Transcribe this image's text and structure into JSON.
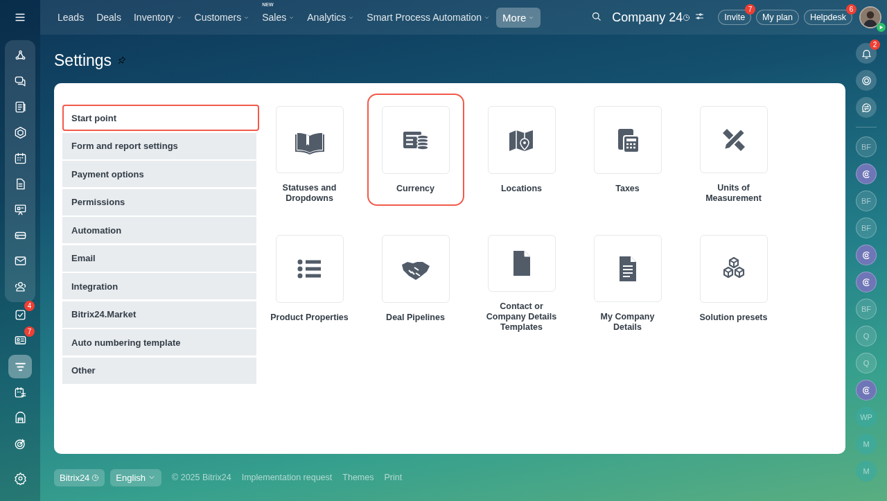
{
  "top_nav": {
    "items": [
      {
        "label": "Leads"
      },
      {
        "label": "Deals"
      },
      {
        "label": "Inventory",
        "dropdown": true
      },
      {
        "label": "Customers",
        "dropdown": true
      },
      {
        "label": "Sales",
        "dropdown": true,
        "tag": "NEW"
      },
      {
        "label": "Analytics",
        "dropdown": true
      },
      {
        "label": "Smart Process Automation",
        "dropdown": true
      },
      {
        "label": "More",
        "dropdown": true,
        "selected": true
      }
    ],
    "company": "Company 24",
    "buttons": [
      {
        "label": "Invite",
        "badge": "7"
      },
      {
        "label": "My plan"
      },
      {
        "label": "Helpdesk",
        "badge": "6"
      }
    ]
  },
  "left_rail": {
    "items": [
      {
        "badge": "4",
        "selected": false
      },
      {
        "badge": "7",
        "selected": false
      },
      {
        "selected": true
      },
      {
        "selected": false
      },
      {
        "selected": false
      },
      {
        "selected": false
      }
    ]
  },
  "page_title": "Settings",
  "settings_menu": [
    {
      "label": "Start point",
      "selected": true,
      "highlighted": true
    },
    {
      "label": "Form and report settings",
      "selected": false,
      "highlighted": false
    },
    {
      "label": "Payment options",
      "selected": false,
      "highlighted": false
    },
    {
      "label": "Permissions",
      "selected": false,
      "highlighted": false
    },
    {
      "label": "Automation",
      "selected": false,
      "highlighted": false
    },
    {
      "label": "Email",
      "selected": false,
      "highlighted": false
    },
    {
      "label": "Integration",
      "selected": false,
      "highlighted": false
    },
    {
      "label": "Bitrix24.Market",
      "selected": false,
      "highlighted": false
    },
    {
      "label": "Auto numbering template",
      "selected": false,
      "highlighted": false
    },
    {
      "label": "Other",
      "selected": false,
      "highlighted": false
    }
  ],
  "tiles": [
    {
      "label": "Statuses and Dropdowns",
      "highlighted": false
    },
    {
      "label": "Currency",
      "highlighted": true
    },
    {
      "label": "Locations",
      "highlighted": false
    },
    {
      "label": "Taxes",
      "highlighted": false
    },
    {
      "label": "Units of Measurement",
      "highlighted": false
    },
    {
      "label": "Product Properties",
      "highlighted": false
    },
    {
      "label": "Deal Pipelines",
      "highlighted": false
    },
    {
      "label": "Contact or Company Details Templates",
      "highlighted": false
    },
    {
      "label": "My Company Details",
      "highlighted": false
    },
    {
      "label": "Solution presets",
      "highlighted": false
    }
  ],
  "right_rail": {
    "notifications_badge": "2",
    "contacts": [
      {
        "kind": "initials",
        "text": "BF"
      },
      {
        "kind": "bot"
      },
      {
        "kind": "initials",
        "text": "BF"
      },
      {
        "kind": "initials",
        "text": "BF"
      },
      {
        "kind": "bot"
      },
      {
        "kind": "bot"
      },
      {
        "kind": "initials",
        "text": "BF"
      },
      {
        "kind": "initials",
        "text": "Q"
      },
      {
        "kind": "initials",
        "text": "Q"
      },
      {
        "kind": "bot"
      },
      {
        "kind": "initials",
        "text": "WP",
        "solid": true
      },
      {
        "kind": "initials",
        "text": "M",
        "solid": true
      },
      {
        "kind": "initials",
        "text": "M",
        "solid": true
      }
    ]
  },
  "footer": {
    "logo": "Bitrix24",
    "language": "English",
    "copyright": "© 2025 Bitrix24",
    "links": [
      "Implementation request",
      "Themes",
      "Print"
    ]
  }
}
